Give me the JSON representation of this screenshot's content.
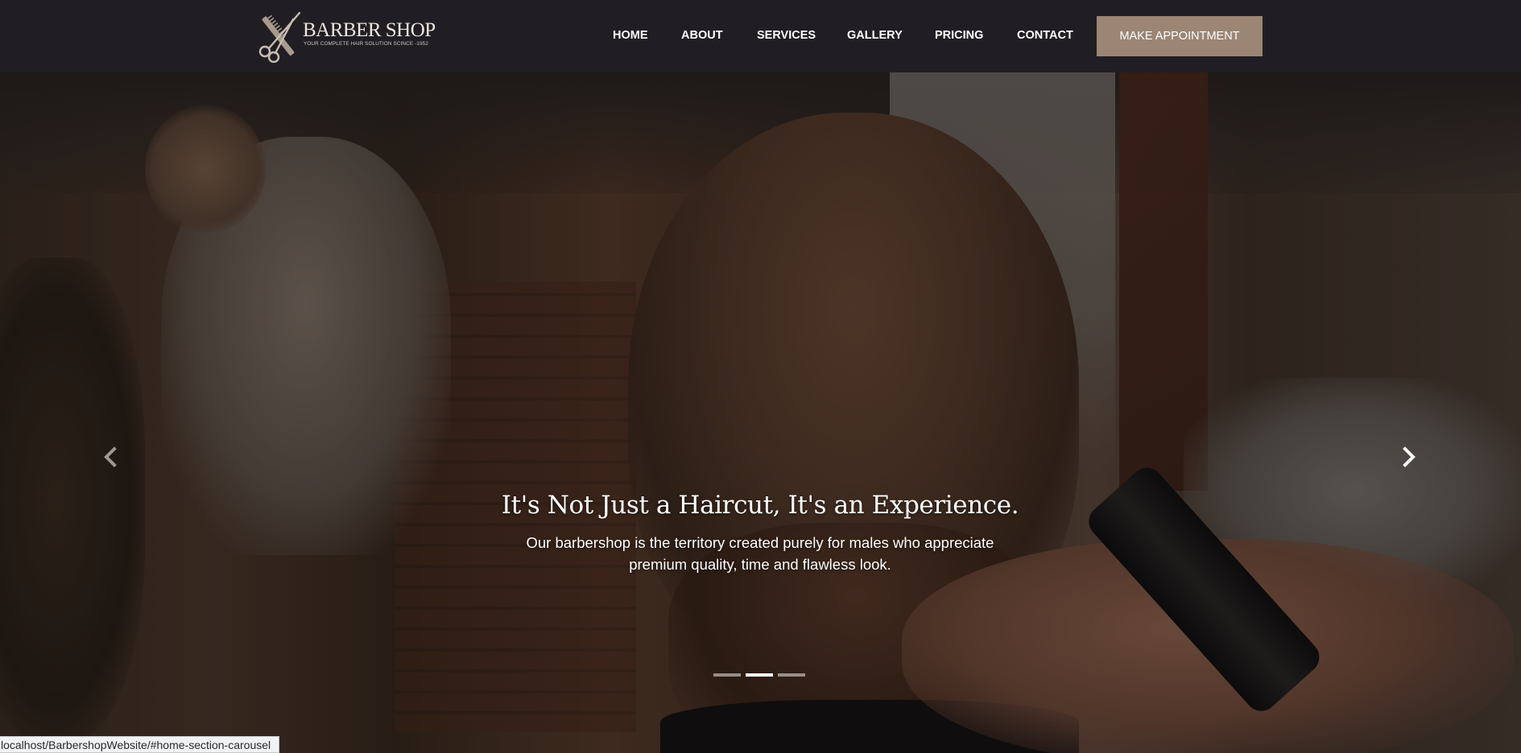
{
  "header": {
    "logo_title": "BARBER SHOP",
    "logo_tagline": "YOUR COMPLETE HAIR SOLUTION SCINCE -1952",
    "nav": [
      "HOME",
      "ABOUT",
      "SERVICES",
      "GALLERY",
      "PRICING",
      "CONTACT"
    ],
    "cta_label": "MAKE APPOINTMENT"
  },
  "carousel": {
    "title": "It's Not Just a Haircut, It's an Experience.",
    "text": "Our barbershop is the territory created purely for males who appreciate premium quality, time and flawless look.",
    "slide_count": 3,
    "active_slide": 2,
    "prev_icon": "chevron-left-icon",
    "next_icon": "chevron-right-icon"
  },
  "status_bar": {
    "url": "localhost/BarbershopWebsite/#home-section-carousel"
  },
  "colors": {
    "header_bg": "#211e23",
    "accent": "#9b8575",
    "text": "#ffffff"
  }
}
